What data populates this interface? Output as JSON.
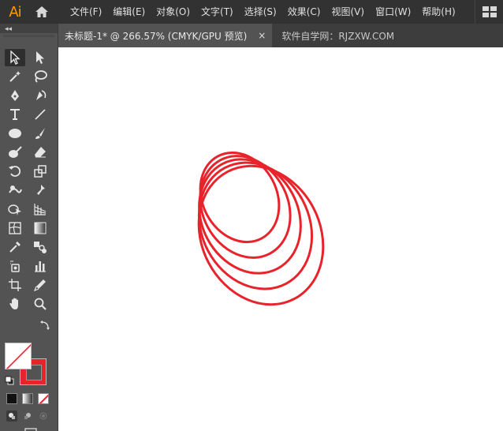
{
  "app": {
    "logo": "Ai"
  },
  "menu": {
    "items": [
      "文件(F)",
      "编辑(E)",
      "对象(O)",
      "文字(T)",
      "选择(S)",
      "效果(C)",
      "视图(V)",
      "窗口(W)",
      "帮助(H)"
    ]
  },
  "tabs": {
    "active": "未标题-1* @ 266.57% (CMYK/GPU 预览)",
    "close_glyph": "×",
    "site": "软件自学网：RJZXW.COM"
  },
  "toolbar": {
    "collapse_glyph": "◂◂"
  },
  "colors": {
    "stroke": "#e8232b",
    "fill": "#ffffff",
    "accent": "#ff9a00",
    "canvas": "#ffffff",
    "ui_dark": "#323232",
    "ui_mid": "#535353"
  },
  "icons": [
    "selection-tool-icon",
    "direct-selection-tool-icon",
    "magic-wand-icon",
    "lasso-icon",
    "pen-tool-icon",
    "curvature-tool-icon",
    "type-tool-icon",
    "line-tool-icon",
    "ellipse-tool-icon",
    "paintbrush-icon",
    "shaper-tool-icon",
    "eraser-icon",
    "rotate-tool-icon",
    "scale-tool-icon",
    "warp-tool-icon",
    "puppet-warp-icon",
    "shape-builder-icon",
    "perspective-grid-icon",
    "mesh-tool-icon",
    "gradient-tool-icon",
    "eyedropper-icon",
    "blend-tool-icon",
    "symbol-sprayer-icon",
    "column-graph-icon",
    "artboard-tool-icon",
    "slice-tool-icon",
    "hand-tool-icon",
    "zoom-tool-icon"
  ]
}
